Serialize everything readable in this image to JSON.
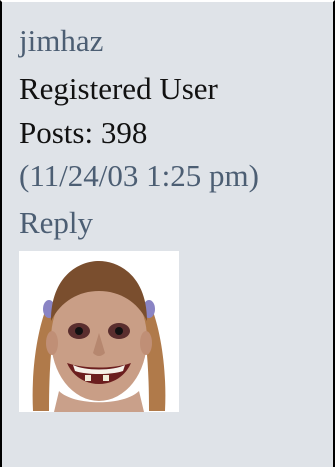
{
  "post": {
    "username": "jimhaz",
    "role": "Registered User",
    "posts": "Posts: 398",
    "timestamp": "(11/24/03 1:25 pm)",
    "reply_label": "Reply"
  },
  "avatar": {
    "icon": "avatar-face-image"
  },
  "colors": {
    "background": "#dfe3e8",
    "link": "#4c5e73",
    "text": "#111111",
    "border": "#000000"
  }
}
